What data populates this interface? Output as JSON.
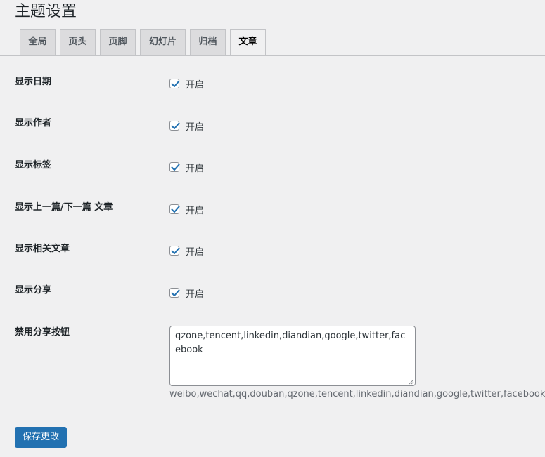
{
  "page_title": "主题设置",
  "tabs": [
    {
      "label": "全局"
    },
    {
      "label": "页头"
    },
    {
      "label": "页脚"
    },
    {
      "label": "幻灯片"
    },
    {
      "label": "归档"
    },
    {
      "label": "文章",
      "active": true
    }
  ],
  "settings": [
    {
      "label": "显示日期",
      "checked": true,
      "option_label": "开启"
    },
    {
      "label": "显示作者",
      "checked": true,
      "option_label": "开启"
    },
    {
      "label": "显示标签",
      "checked": true,
      "option_label": "开启"
    },
    {
      "label": "显示上一篇/下一篇 文章",
      "checked": true,
      "option_label": "开启"
    },
    {
      "label": "显示相关文章",
      "checked": true,
      "option_label": "开启"
    },
    {
      "label": "显示分享",
      "checked": true,
      "option_label": "开启"
    }
  ],
  "disable_share": {
    "label": "禁用分享按钮",
    "value": "qzone,tencent,linkedin,diandian,google,twitter,facebook",
    "description": "weibo,wechat,qq,douban,qzone,tencent,linkedin,diandian,google,twitter,facebook"
  },
  "save_button": {
    "label": "保存更改"
  },
  "colors": {
    "accent": "#2271b1",
    "background": "#f0f0f1",
    "tab_inactive": "#dcdcde"
  }
}
